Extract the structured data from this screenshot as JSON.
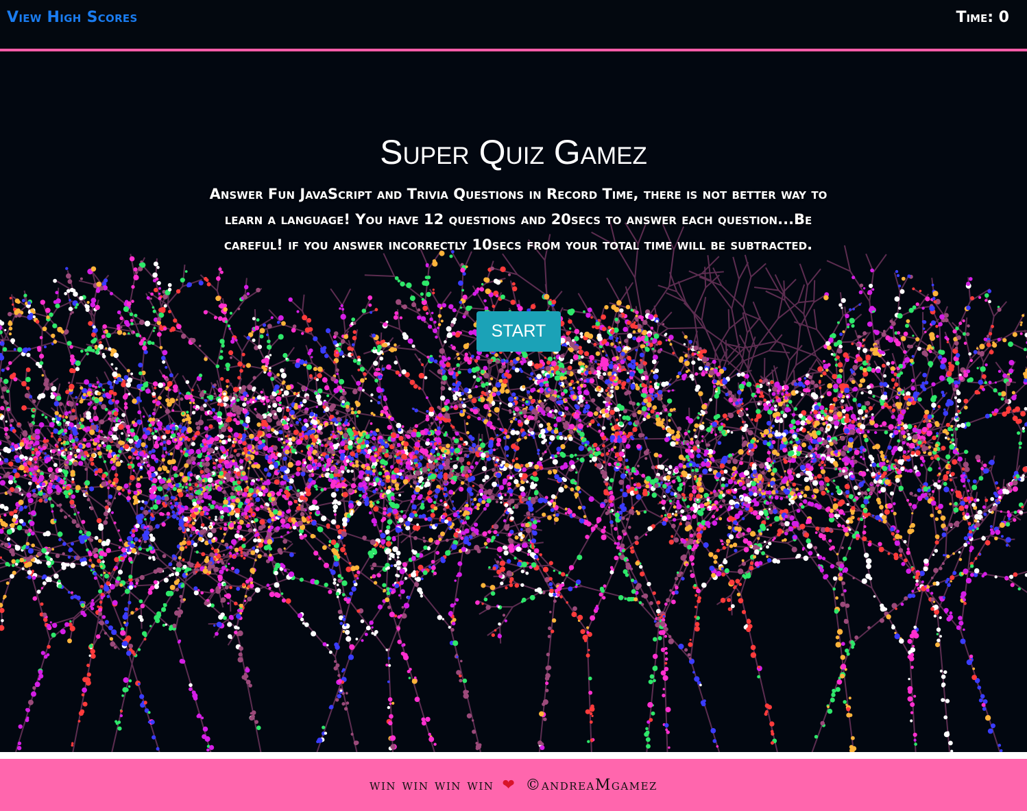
{
  "header": {
    "high_scores_label": "View High Scores",
    "timer_label": "Time: 0"
  },
  "main": {
    "title": "Super Quiz Gamez",
    "description": "Answer Fun JavaScript and Trivia Questions in Record Time, there is not better way to learn a language! You have 12 questions and 20secs to answer each question...Be careful! if you answer incorrectly 10secs from your total time will be subtracted.",
    "start_label": "START"
  },
  "footer": {
    "text_left": "win win win win",
    "heart": "❤",
    "text_right": "©andreaMgamez"
  },
  "background": {
    "subject": "string lights on trees at night",
    "colors": [
      "#ff2fcf",
      "#d51ee6",
      "#3a3cff",
      "#ffb43a",
      "#2ee86a",
      "#ff3b3b",
      "#ffffff",
      "#9b4a7a"
    ]
  },
  "colors": {
    "accent_pink": "#ff5ca8",
    "link_blue": "#1a7cf0",
    "start_button": "#1ba2b7",
    "footer_bg": "#ff66ad"
  }
}
